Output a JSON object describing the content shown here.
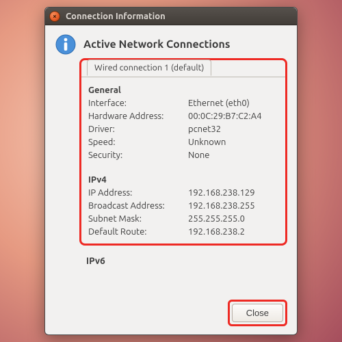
{
  "window": {
    "title": "Connection Information"
  },
  "heading": "Active Network Connections",
  "tab_label": "Wired connection 1 (default)",
  "sections": {
    "general": {
      "title": "General",
      "rows": [
        {
          "label": "Interface:",
          "value": "Ethernet (eth0)"
        },
        {
          "label": "Hardware Address:",
          "value": "00:0C:29:B7:C2:A4"
        },
        {
          "label": "Driver:",
          "value": "pcnet32"
        },
        {
          "label": "Speed:",
          "value": "Unknown"
        },
        {
          "label": "Security:",
          "value": "None"
        }
      ]
    },
    "ipv4": {
      "title": "IPv4",
      "rows": [
        {
          "label": "IP Address:",
          "value": "192.168.238.129"
        },
        {
          "label": "Broadcast Address:",
          "value": "192.168.238.255"
        },
        {
          "label": "Subnet Mask:",
          "value": "255.255.255.0"
        },
        {
          "label": "Default Route:",
          "value": "192.168.238.2"
        }
      ]
    },
    "ipv6": {
      "title": "IPv6"
    }
  },
  "buttons": {
    "close": "Close"
  },
  "highlight_color": "#ee2a24"
}
